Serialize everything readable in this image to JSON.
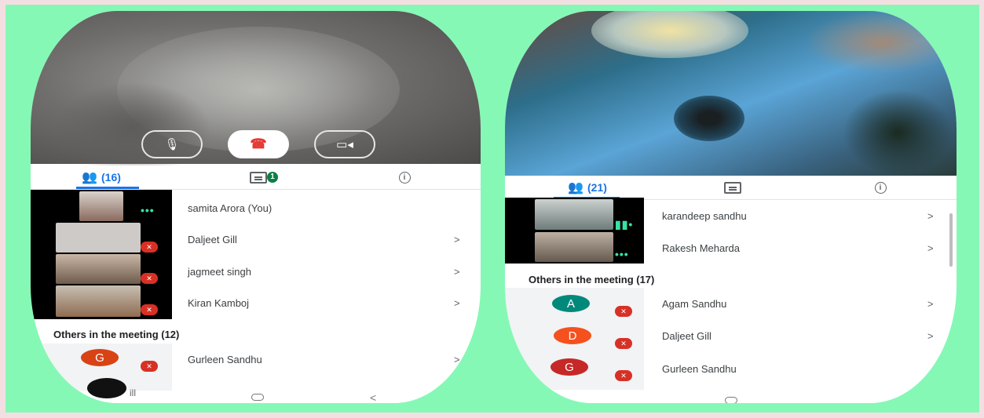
{
  "left_phone": {
    "controls": {
      "mic_icon": "mic-icon",
      "end_call_icon": "end-call-icon",
      "camera_icon": "camera-icon"
    },
    "tabs": {
      "participants_count": "(16)",
      "chat_badge": "1"
    },
    "participants": [
      {
        "name": "samita Arora (You)",
        "chevron": ""
      },
      {
        "name": "Daljeet Gill",
        "chevron": ">"
      },
      {
        "name": "jagmeet singh",
        "chevron": ">"
      },
      {
        "name": "Kiran Kamboj",
        "chevron": ">"
      }
    ],
    "others_heading": "Others in the meeting (12)",
    "others": [
      {
        "initial": "G",
        "name": "Gurleen Sandhu",
        "chevron": ">",
        "color": "#d84315"
      }
    ],
    "partial_text": "ill"
  },
  "right_phone": {
    "tabs": {
      "participants_count": "(21)"
    },
    "participants": [
      {
        "name": "karandeep sandhu",
        "chevron": ">"
      },
      {
        "name": "Rakesh Meharda",
        "chevron": ">"
      }
    ],
    "others_heading": "Others in the meeting (17)",
    "others": [
      {
        "initial": "A",
        "name": "Agam Sandhu",
        "chevron": ">",
        "color": "#00897b"
      },
      {
        "initial": "D",
        "name": "Daljeet Gill",
        "chevron": ">",
        "color": "#f4511e"
      },
      {
        "initial": "G",
        "name": "Gurleen Sandhu",
        "chevron": "",
        "color": "#c62828"
      }
    ]
  },
  "colors": {
    "background": "#86f8b5",
    "accent": "#1a73e8",
    "mute": "#d93025",
    "end_call": "#e53935"
  }
}
